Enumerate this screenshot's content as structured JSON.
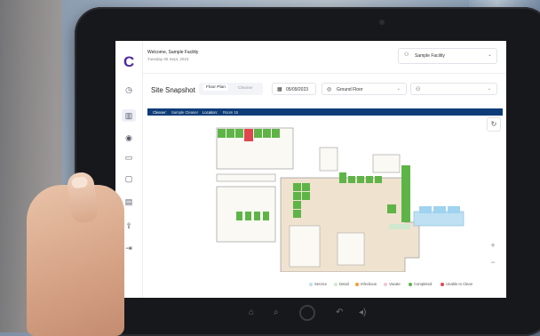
{
  "app": {
    "welcome": "Welcome, Sample Facility",
    "date": "Tuesday 05 Sept, 2023",
    "facility_select": "Sample Facility",
    "logo_glyph": "C"
  },
  "sidebar": {
    "items": [
      {
        "icon": "dashboard-icon",
        "glyph": "◷"
      },
      {
        "icon": "site-snapshot-icon",
        "glyph": "▥"
      },
      {
        "icon": "eye-icon",
        "glyph": "◉"
      },
      {
        "icon": "monitor-icon",
        "glyph": "▭"
      },
      {
        "icon": "calendar-icon",
        "glyph": "▢"
      },
      {
        "icon": "report-icon",
        "glyph": "▤"
      },
      {
        "icon": "upload-icon",
        "glyph": "⇪"
      },
      {
        "icon": "logout-icon",
        "glyph": "⇥"
      }
    ]
  },
  "toolbar": {
    "title": "Site Snapshot",
    "tab_floor_plan": "Floor Plan",
    "tab_cleaner": "Cleaner",
    "date_value": "05/09/2023",
    "floor_value": "Ground Floor",
    "user_value": ""
  },
  "strip": {
    "cleaner_label": "Cleaner:",
    "cleaner_value": "Sample Cleaner",
    "location_label": "Location:",
    "location_value": "Room 15"
  },
  "legend": [
    {
      "label": "Service",
      "color": "#bfe0f2"
    },
    {
      "label": "Detail",
      "color": "#cfe8cf"
    },
    {
      "label": "Infectious",
      "color": "#f0a030"
    },
    {
      "label": "Vacate",
      "color": "#f7c6cf"
    },
    {
      "label": "Completed",
      "color": "#5fb447"
    },
    {
      "label": "Unable to Clean",
      "color": "#e0464e"
    }
  ],
  "colors": {
    "accent": "#4b2aa3",
    "strip": "#0d3c78",
    "completed": "#5fb447",
    "unable": "#e0464e",
    "service": "#9fd3ef"
  },
  "tablet_nav": {
    "home_glyph": "⌂",
    "search_glyph": "⌕",
    "back_glyph": "↶",
    "volume_glyph": "◂)"
  }
}
